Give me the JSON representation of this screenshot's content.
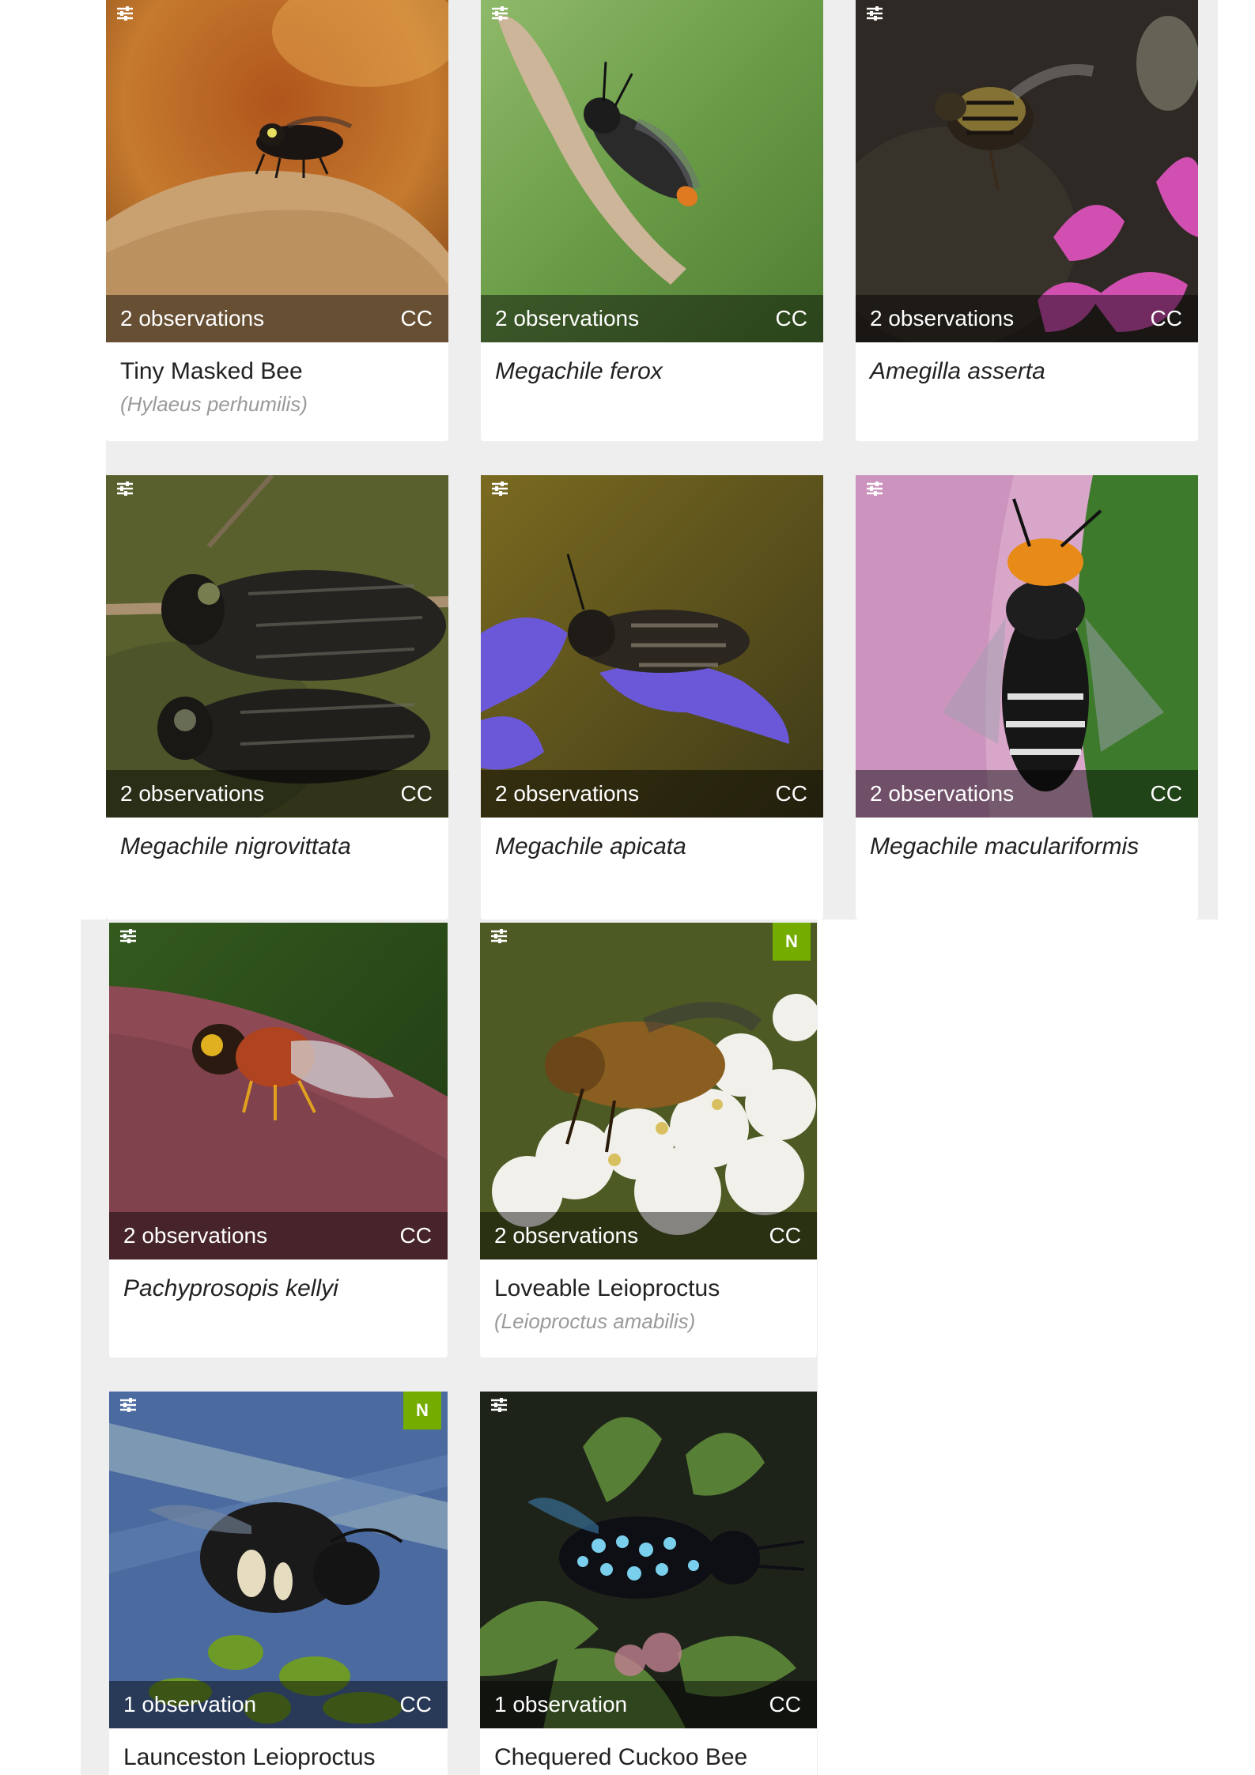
{
  "grid": {
    "cards": [
      {
        "observations": "2 observations",
        "license": "CC",
        "common_name": "Tiny Masked Bee",
        "scientific_name": "(Hylaeus perhumilis)",
        "badge": null
      },
      {
        "observations": "2 observations",
        "license": "CC",
        "common_name": "",
        "scientific_name": "Megachile ferox",
        "badge": null
      },
      {
        "observations": "2 observations",
        "license": "CC",
        "common_name": "",
        "scientific_name": "Amegilla asserta",
        "badge": null
      },
      {
        "observations": "2 observations",
        "license": "CC",
        "common_name": "",
        "scientific_name": "Megachile nigrovittata",
        "badge": null
      },
      {
        "observations": "2 observations",
        "license": "CC",
        "common_name": "",
        "scientific_name": "Megachile apicata",
        "badge": null
      },
      {
        "observations": "2 observations",
        "license": "CC",
        "common_name": "",
        "scientific_name": "Megachile maculariformis",
        "badge": null
      },
      {
        "observations": "2 observations",
        "license": "CC",
        "common_name": "",
        "scientific_name": "Pachyprosopis kellyi",
        "badge": null
      },
      {
        "observations": "2 observations",
        "license": "CC",
        "common_name": "Loveable Leioproctus",
        "scientific_name": "(Leioproctus amabilis)",
        "badge": "N"
      },
      {
        "observations": "1 observation",
        "license": "CC",
        "common_name": "Launceston Leioproctus",
        "scientific_name": "",
        "badge": "N"
      },
      {
        "observations": "1 observation",
        "license": "CC",
        "common_name": "Chequered Cuckoo Bee",
        "scientific_name": "",
        "badge": null
      }
    ]
  },
  "icons": {
    "photo_menu": "sliders-icon",
    "native_badge": "native-badge"
  },
  "colors": {
    "native_badge": "#74ac00",
    "caption_overlay": "rgba(0,0,0,0.45)",
    "page_gutter": "#eeeeee",
    "subtitle": "#9a9a9a"
  }
}
